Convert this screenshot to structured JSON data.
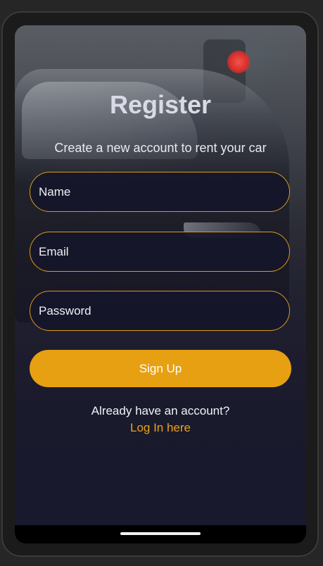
{
  "screen": {
    "title": "Register",
    "subtitle": "Create a new account to rent your car"
  },
  "form": {
    "name_placeholder": "Name",
    "email_placeholder": "Email",
    "password_placeholder": "Password",
    "submit_label": "Sign Up"
  },
  "footer": {
    "prompt": "Already have an account?",
    "login_link": "Log In here"
  },
  "colors": {
    "accent": "#e6a012",
    "field_border": "#d99a1c",
    "background": "#17172a"
  }
}
